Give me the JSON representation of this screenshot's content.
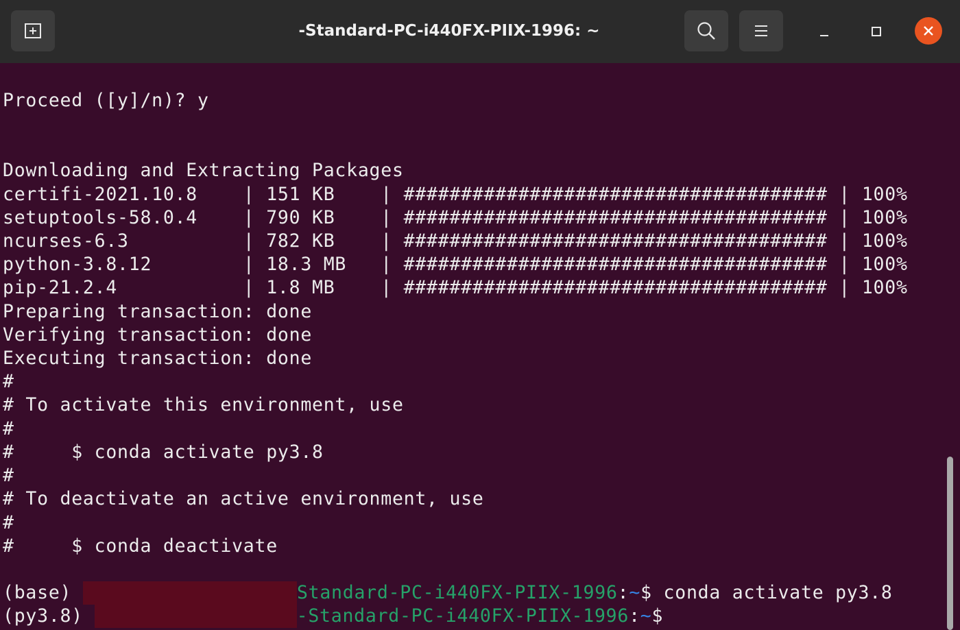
{
  "window": {
    "title": "-Standard-PC-i440FX-PIIX-1996: ~",
    "colors": {
      "terminal_bg": "#380c2a",
      "titlebar_bg": "#2b2b2b",
      "prompt_green": "#26a269",
      "prompt_blue": "#3584e4",
      "close_orange": "#e95420"
    },
    "icons": {
      "new_tab": "new-tab-icon",
      "search": "search-icon",
      "menu": "hamburger-menu-icon",
      "minimize": "minimize-icon",
      "maximize": "maximize-icon",
      "close": "close-icon"
    }
  },
  "terminal": {
    "proceed": "Proceed ([y]/n)? y",
    "downloading_header": "Downloading and Extracting Packages",
    "packages": [
      "certifi-2021.10.8    | 151 KB    | ##################################### | 100%",
      "setuptools-58.0.4    | 790 KB    | ##################################### | 100%",
      "ncurses-6.3          | 782 KB    | ##################################### | 100%",
      "python-3.8.12        | 18.3 MB   | ##################################### | 100%",
      "pip-21.2.4           | 1.8 MB    | ##################################### | 100%"
    ],
    "status_lines": [
      "Preparing transaction: done",
      "Verifying transaction: done",
      "Executing transaction: done",
      "#",
      "# To activate this environment, use",
      "#",
      "#     $ conda activate py3.8",
      "#",
      "# To deactivate an active environment, use",
      "#",
      "#     $ conda deactivate"
    ],
    "prompt1": {
      "env": "(base) ",
      "host": "Standard-PC-i440FX-PIIX-1996",
      "colon": ":",
      "path": "~",
      "dollar": "$ ",
      "command": "conda activate py3.8"
    },
    "prompt2": {
      "env": "(py3.8) ",
      "host": "-Standard-PC-i440FX-PIIX-1996",
      "colon": ":",
      "path": "~",
      "dollar": "$"
    }
  }
}
